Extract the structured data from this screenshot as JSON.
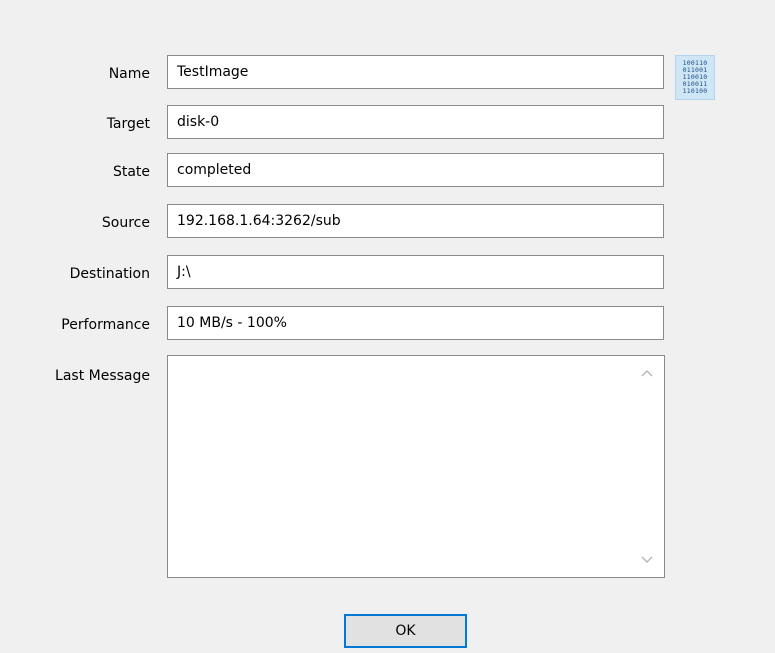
{
  "fields": [
    {
      "label": "Name",
      "value": "TestImage"
    },
    {
      "label": "Target",
      "value": "disk-0"
    },
    {
      "label": "State",
      "value": "completed"
    },
    {
      "label": "Source",
      "value": "192.168.1.64:3262/sub"
    },
    {
      "label": "Destination",
      "value": "J:\\"
    },
    {
      "label": "Performance",
      "value": "10 MB/s - 100%"
    }
  ],
  "last_message": {
    "label": "Last Message",
    "value": ""
  },
  "icon": {
    "name": "binary-data-icon",
    "lines": [
      "100110",
      "011001",
      "110010",
      "010011",
      "110100"
    ]
  },
  "ok_button": {
    "label": "OK"
  },
  "colors": {
    "background": "#f0f0f0",
    "field_border": "#8a8a8a",
    "button_focus": "#0078d7",
    "icon_bg": "#cfe6f7"
  }
}
